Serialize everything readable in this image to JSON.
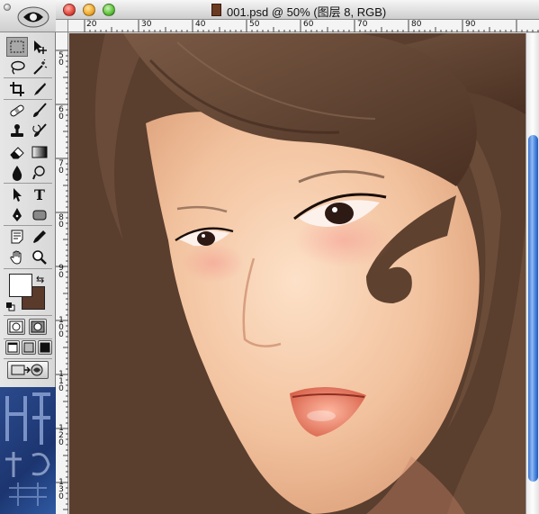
{
  "document": {
    "title": "001.psd @ 50% (图层 8, RGB)"
  },
  "rulers": {
    "top_labels": [
      "20",
      "30",
      "40",
      "50",
      "60",
      "70",
      "80",
      "90"
    ],
    "left_labels": [
      "5\n0",
      "6\n0",
      "7\n0",
      "8\n0",
      "9\n0",
      "1\n0\n0",
      "1\n1\n0",
      "1\n2\n0",
      "1\n3\n0"
    ]
  },
  "colors": {
    "foreground": "#ffffff",
    "background": "#5a3a2a",
    "canvas_bg": "#5a3e2e",
    "scroll_thumb": "#3a73d0"
  },
  "tools": [
    "rect-marquee",
    "move",
    "lasso",
    "magic-wand",
    "crop",
    "slice",
    "healing-brush",
    "brush",
    "clone-stamp",
    "history-brush",
    "eraser",
    "gradient",
    "blur",
    "dodge",
    "path-selection",
    "type",
    "pen",
    "shape",
    "notes",
    "eyedropper",
    "hand",
    "zoom"
  ]
}
